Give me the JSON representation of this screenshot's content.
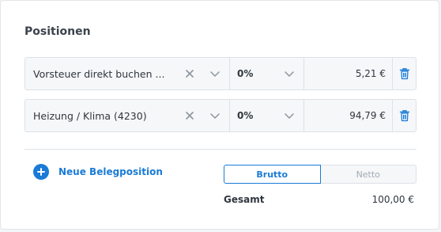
{
  "section": {
    "title": "Positionen"
  },
  "rows": [
    {
      "account": "Vorsteuer direkt buchen ...",
      "tax": "0%",
      "amount": "5,21 €"
    },
    {
      "account": "Heizung / Klima (4230)",
      "tax": "0%",
      "amount": "94,79 €"
    }
  ],
  "add_button": {
    "label": "Neue Belegposition"
  },
  "toggle": {
    "brutto": "Brutto",
    "netto": "Netto",
    "selected": "Brutto"
  },
  "total": {
    "label": "Gesamt",
    "value": "100,00 €"
  },
  "colors": {
    "accent": "#1a7bd6",
    "row_bg": "#f5f7f9",
    "border": "#dde2e7"
  },
  "icons": [
    "clear-icon",
    "chevron-down-icon",
    "trash-icon",
    "plus-circle-icon"
  ]
}
